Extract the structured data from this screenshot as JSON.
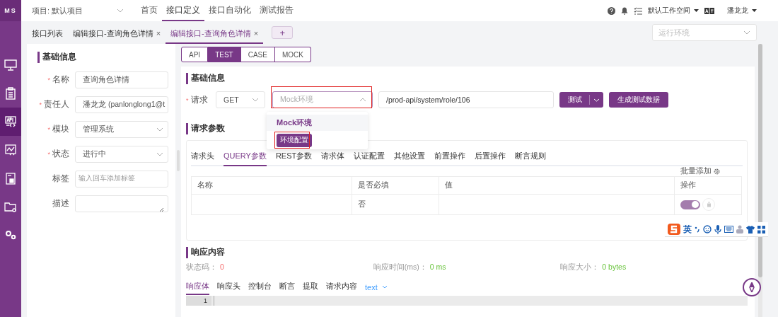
{
  "logo": "MS",
  "header": {
    "project": "项目: 默认项目",
    "nav": [
      {
        "label": "首页",
        "selected": false
      },
      {
        "label": "接口定义",
        "selected": true
      },
      {
        "label": "接口自动化",
        "selected": false
      },
      {
        "label": "测试报告",
        "selected": false
      }
    ],
    "workspace": "默认工作空间",
    "user": "潘龙龙"
  },
  "sidebar": {
    "items": [
      {
        "kind": "monitor",
        "selected": false
      },
      {
        "kind": "clipboard",
        "selected": false
      },
      {
        "kind": "api",
        "selected": true
      },
      {
        "kind": "chart",
        "selected": false
      },
      {
        "kind": "document",
        "selected": false
      },
      {
        "kind": "folder",
        "selected": false
      },
      {
        "kind": "gears",
        "selected": false
      }
    ]
  },
  "tabs": [
    {
      "label": "接口列表",
      "selected": false
    },
    {
      "label": "编辑接口-查询角色详情",
      "selected": false,
      "close": "×"
    },
    {
      "label": "编辑接口-查询角色详情",
      "selected": true,
      "close": "×"
    }
  ],
  "add_tab": "+",
  "run_env": {
    "placeholder": "运行环境"
  },
  "basic_info": {
    "title": "基础信息",
    "fields": [
      {
        "label": "名称",
        "required_mark": "*",
        "kind": "input",
        "value": "查询角色详情"
      },
      {
        "label": "责任人",
        "required_mark": "*",
        "kind": "select",
        "value": "潘龙龙 (panlonglong1@t"
      },
      {
        "label": "模块",
        "required_mark": "*",
        "kind": "select",
        "value": "管理系统"
      },
      {
        "label": "状态",
        "required_mark": "*",
        "kind": "select",
        "value": "进行中"
      },
      {
        "label": "标签",
        "kind": "input",
        "placeholder": "输入回车添加标签"
      },
      {
        "label": "描述",
        "kind": "textarea"
      }
    ]
  },
  "mode_tabs": [
    {
      "label": "API",
      "selected": false
    },
    {
      "label": "TEST",
      "selected": true
    },
    {
      "label": "CASE",
      "selected": false
    },
    {
      "label": "MOCK",
      "selected": false
    }
  ],
  "request": {
    "section_title": "基础信息",
    "label": "请求",
    "required_mark": "*",
    "method": "GET",
    "env": {
      "placeholder": "Mock环境",
      "expanded": true,
      "highlighted": true
    },
    "url": "/prod-api/system/role/106",
    "test_button": "测试",
    "generate_button": "生成测试数据"
  },
  "env_dropdown": {
    "group": "Mock环境",
    "action": "环境配置",
    "action_highlighted": true
  },
  "params": {
    "title": "请求参数",
    "tabs": [
      {
        "label": "请求头",
        "selected": false
      },
      {
        "label": "QUERY参数",
        "selected": true
      },
      {
        "label": "REST参数",
        "selected": false
      },
      {
        "label": "请求体",
        "selected": false
      },
      {
        "label": "认证配置",
        "selected": false
      },
      {
        "label": "其他设置",
        "selected": false
      },
      {
        "label": "前置操作",
        "selected": false
      },
      {
        "label": "后置操作",
        "selected": false
      },
      {
        "label": "断言规则",
        "selected": false
      }
    ],
    "batch_add": "批量添加",
    "columns": [
      "名称",
      "是否必填",
      "值",
      "操作"
    ],
    "rows": [
      {
        "required": "否",
        "enabled": true
      }
    ]
  },
  "response": {
    "title": "响应内容",
    "stats": [
      {
        "label": "状态码：",
        "value": "0",
        "kind": "error"
      },
      {
        "label": "响应时间(ms)：",
        "value": "0 ms",
        "kind": "ok"
      },
      {
        "label": "响应大小：",
        "value": "0 bytes",
        "kind": "ok"
      }
    ],
    "tabs": [
      {
        "label": "响应体",
        "selected": true
      },
      {
        "label": "响应头",
        "selected": false
      },
      {
        "label": "控制台",
        "selected": false
      },
      {
        "label": "断言",
        "selected": false
      },
      {
        "label": "提取",
        "selected": false
      },
      {
        "label": "请求内容",
        "selected": false
      }
    ],
    "format": "text",
    "line_numbers": [
      "1"
    ]
  },
  "ime_toolbar": {
    "mode": "英"
  }
}
